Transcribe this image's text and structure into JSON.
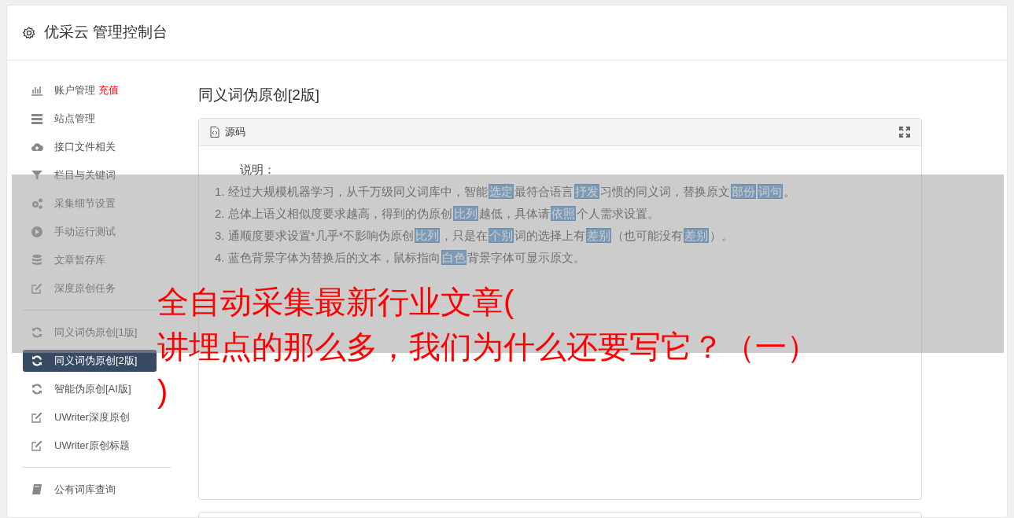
{
  "header": {
    "title": "优采云 管理控制台"
  },
  "sidebar": {
    "groups": [
      {
        "items": [
          {
            "kind": "bars",
            "label": "账户管理",
            "badge": "充值",
            "selected": false
          },
          {
            "kind": "server",
            "label": "站点管理",
            "selected": false
          },
          {
            "kind": "cloud",
            "label": "接口文件相关",
            "selected": false
          },
          {
            "kind": "filter",
            "label": "栏目与关键词",
            "selected": false
          },
          {
            "kind": "gears",
            "label": "采集细节设置",
            "selected": false
          },
          {
            "kind": "play",
            "label": "手动运行测试",
            "selected": false
          },
          {
            "kind": "database",
            "label": "文章暂存库",
            "selected": false
          },
          {
            "kind": "edit",
            "label": "深度原创任务",
            "selected": false
          }
        ]
      },
      {
        "items": [
          {
            "kind": "refresh",
            "label": "同义词伪原创[1版]",
            "selected": false
          },
          {
            "kind": "refresh",
            "label": "同义词伪原创[2版]",
            "selected": true
          },
          {
            "kind": "refresh",
            "label": "智能伪原创[AI版]",
            "selected": false
          },
          {
            "kind": "edit",
            "label": "UWriter深度原创",
            "selected": false
          },
          {
            "kind": "edit",
            "label": "UWriter原创标题",
            "selected": false
          }
        ]
      },
      {
        "items": [
          {
            "kind": "book",
            "label": "公有词库查询",
            "selected": false
          }
        ]
      }
    ]
  },
  "content": {
    "title": "同义词伪原创[2版]",
    "panel": {
      "title": "源码",
      "intro": "说明：",
      "lines": [
        [
          {
            "text": "1. 经过大规模机器学习，从千万级同义词库中，智能"
          },
          {
            "text": "选定",
            "replaced": true
          },
          {
            "text": "最符合语言"
          },
          {
            "text": "抒发",
            "replaced": true
          },
          {
            "text": "习惯的同义词，替换原文"
          },
          {
            "text": "部份",
            "replaced": true
          },
          {
            "text": "词句",
            "replaced": true
          },
          {
            "text": "。"
          }
        ],
        [
          {
            "text": "2. 总体上语义相似度要求越高，得到的伪原创"
          },
          {
            "text": "比列",
            "replaced": true
          },
          {
            "text": "越低，具体请"
          },
          {
            "text": "依照",
            "replaced": true
          },
          {
            "text": "个人需求设置。"
          }
        ],
        [
          {
            "text": "3. 通顺度要求设置*几乎*不影响伪原创"
          },
          {
            "text": "比列",
            "replaced": true
          },
          {
            "text": "，只是在"
          },
          {
            "text": "个别",
            "replaced": true
          },
          {
            "text": "词的选择上有"
          },
          {
            "text": "差别",
            "replaced": true
          },
          {
            "text": "（也可能没有"
          },
          {
            "text": "差别",
            "replaced": true
          },
          {
            "text": "）。"
          }
        ],
        [
          {
            "text": "4. 蓝色背景字体为替换后的文本，鼠标指向"
          },
          {
            "text": "白色",
            "replaced": true
          },
          {
            "text": "背景字体可显示原文。"
          }
        ]
      ]
    }
  },
  "overlay": {
    "title_lines": [
      "全自动采集最新行业文章(",
      "讲埋点的那么多，我们为什么还要写它？（一）",
      ")"
    ]
  }
}
